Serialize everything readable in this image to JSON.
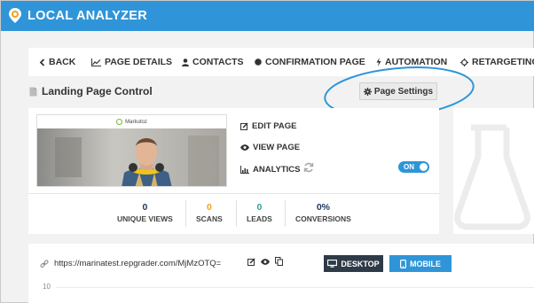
{
  "app": {
    "brand": "LOCAL ANALYZER",
    "accent_color": "#2f95d8",
    "dark_button_color": "#2e3a47"
  },
  "nav": {
    "items": [
      {
        "label": "BACK",
        "icon": "chevron-left-icon"
      },
      {
        "label": "PAGE DETAILS",
        "icon": "line-chart-icon"
      },
      {
        "label": "CONTACTS",
        "icon": "user-icon"
      },
      {
        "label": "CONFIRMATION PAGE",
        "icon": "circle-icon"
      },
      {
        "label": "AUTOMATION",
        "icon": "bolt-icon"
      },
      {
        "label": "RETARGETING",
        "icon": "crosshair-icon"
      }
    ]
  },
  "header": {
    "title": "Landing Page Control",
    "title_icon": "file-icon",
    "settings_label": "Page Settings",
    "settings_icon": "gear-icon"
  },
  "preview": {
    "site_name": "Markutoz"
  },
  "actions": {
    "edit": "EDIT PAGE",
    "view": "VIEW PAGE",
    "analytics": "ANALYTICS",
    "toggle_label": "ON",
    "toggle_state": "on"
  },
  "stats": [
    {
      "value": "0",
      "label": "UNIQUE VIEWS",
      "color": "#1d3a5c"
    },
    {
      "value": "0",
      "label": "SCANS",
      "color": "#f2a21b"
    },
    {
      "value": "0",
      "label": "LEADS",
      "color": "#2aa198"
    },
    {
      "value": "0%",
      "label": "CONVERSIONS",
      "color": "#1d3a5c"
    }
  ],
  "url_bar": {
    "url": "https://marinatest.repgrader.com/MjMzOTQ=",
    "desktop_label": "DESKTOP",
    "mobile_label": "MOBILE"
  },
  "chart": {
    "y_tick_top": "10"
  }
}
